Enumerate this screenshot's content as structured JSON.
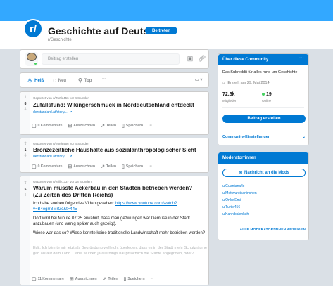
{
  "subreddit": {
    "title": "Geschichte auf Deutsch",
    "name": "r/Geschichte",
    "join_label": "Beitreten",
    "icon_text": "r/"
  },
  "create_post": {
    "placeholder": "Beitrag erstellen"
  },
  "sort": {
    "hot": "Heiß",
    "new": "Neu",
    "top": "Top",
    "more": "···",
    "view": "▭ ▾"
  },
  "posts": [
    {
      "meta": "Gepostet von u/Turtle456 vor 4 Stunden",
      "score": "8",
      "title": "Zufallsfund: Wikingerschmuck in Norddeutschland entdeckt",
      "domain": "derstandard.at/story/... ↗",
      "comments": "0 Kommentare",
      "award": "Auszeichnen",
      "share": "Teilen",
      "save": "Speichern",
      "more": "···"
    },
    {
      "meta": "Gepostet von u/Turtle456 vor 4 Stunden",
      "score": "1",
      "title": "Bronzezeitliche Haushalte aus sozialanthropologischer Sicht",
      "domain": "derstandard.at/story/... ↗",
      "comments": "0 Kommentare",
      "award": "Auszeichnen",
      "share": "Teilen",
      "save": "Speichern",
      "more": "···"
    },
    {
      "meta": "Gepostet von u/reilly1337 vor 18 Stunden",
      "score": "5",
      "title": "Warum musste Ackerbau in den Städten betrieben werden? (Zu Zeiten des Dritten Reichs)",
      "p1_prefix": "Ich habe soeben folgendes Video gesehen: ",
      "p1_link": "https://www.youtube.com/watch?v=B4egrrBMrGc&t=445",
      "p2": "Dort wird bei Minute 07:25 erwähnt, dass man gezwungen war Gemüse in der Stadt anzubauen (und wenig später auch gezeigt).",
      "p3": "Wieso war das so? Wieso konnte keine traditionelle Landwirtschaft mehr betrieben werden?",
      "p4": "Edit: Ich könnte mir jetzt als Begründung vielleicht überlegen, dass es in der Stadt mehr Schutzräume gab als auf dem Land. Dabei wurden ja allerdings hauptsächlich die Städte angegriffen, oder?",
      "comments": "11 Kommentare",
      "award": "Auszeichnen",
      "share": "Teilen",
      "save": "Speichern",
      "more": "···"
    }
  ],
  "about": {
    "header": "Über diese Community",
    "dots": "···",
    "description": "Das Subreddit für alles rund um Geschichte",
    "created": "Erstellt am 29. Mai 2014",
    "members_value": "72.6k",
    "members_label": "Mitglieder",
    "online_value": "19",
    "online_label": "Online",
    "create_post_label": "Beitrag erstellen",
    "settings_label": "Community-Einstellungen",
    "settings_chevron": "⌄"
  },
  "moderators": {
    "header": "Moderator*innen",
    "message_label": "Nachricht an die Mods",
    "list": [
      "u/Guantanaflo",
      "u/Mettwurstkaninchen",
      "u/OnkelEmil",
      "u/Turtle456",
      "u/Kannibalenkuh"
    ],
    "all_label": "ALLE MODERATOR*INNEN ANZEIGEN"
  },
  "colors": {
    "accent": "#0079d3",
    "banner": "#33a8ff",
    "background": "#dae0e6"
  }
}
